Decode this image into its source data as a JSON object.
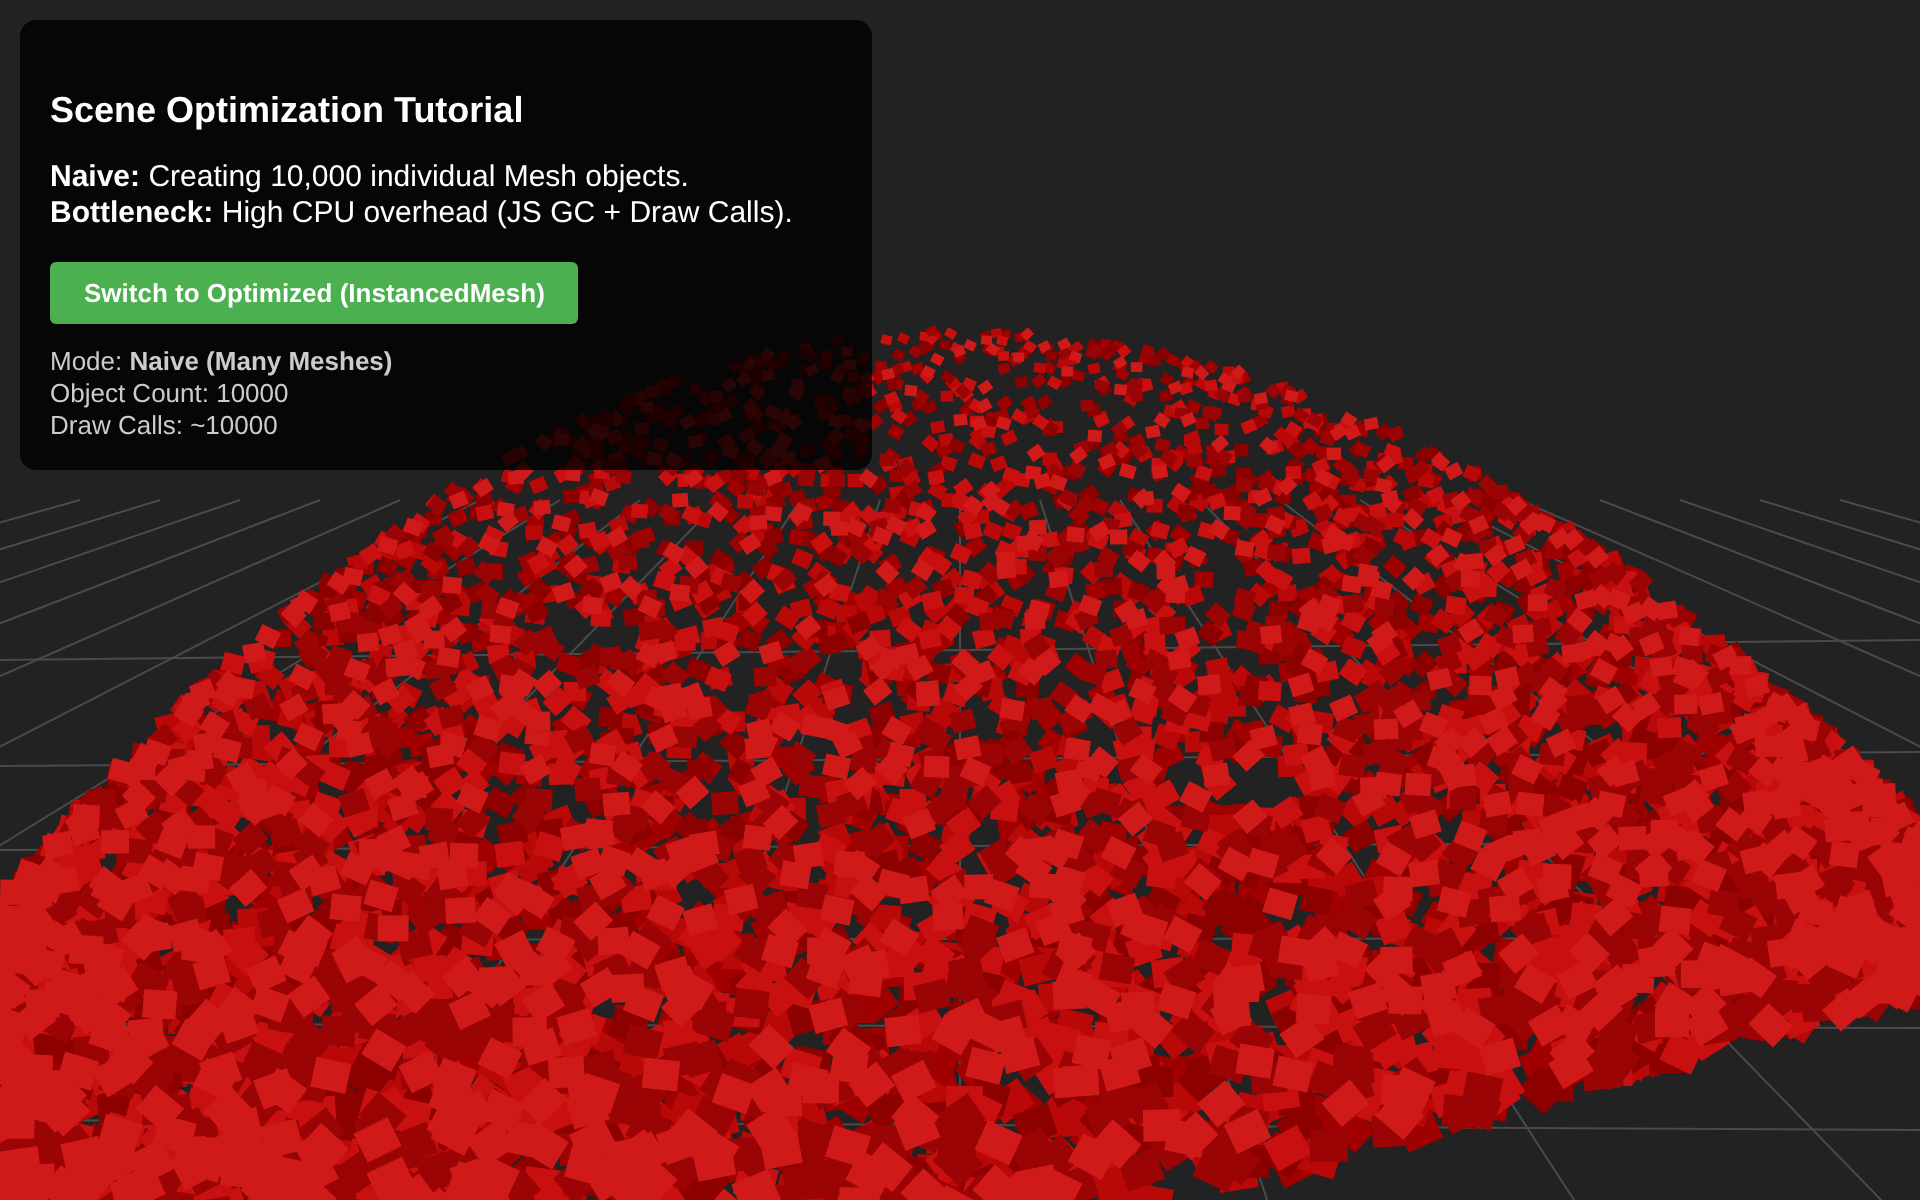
{
  "panel": {
    "title": "Scene Optimization Tutorial",
    "description": [
      "**Naive:** Creating 10,000 individual Mesh objects.",
      "**Bottleneck:** High CPU overhead (JS GC + Draw Calls)."
    ],
    "button": "Switch to Optimized (InstancedMesh)",
    "stats": [
      "Mode: **Naive (Many Meshes)**",
      "Object Count: 10000",
      "Draw Calls: ~10000"
    ]
  }
}
